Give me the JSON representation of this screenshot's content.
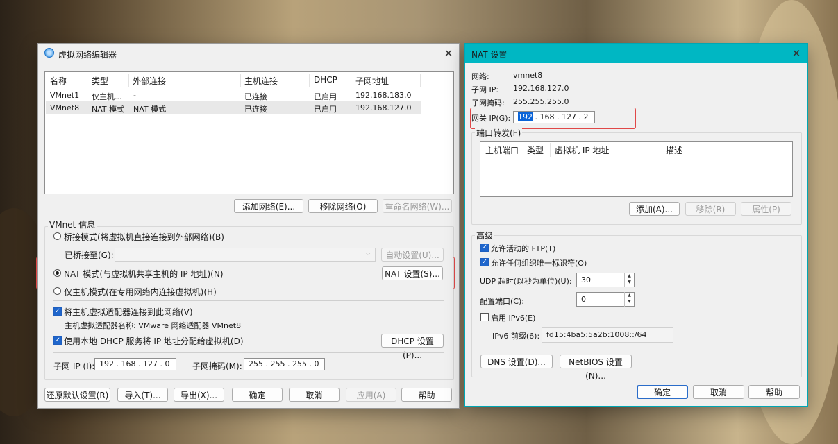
{
  "vne": {
    "title": "虚拟网络编辑器",
    "columns": [
      "名称",
      "类型",
      "外部连接",
      "主机连接",
      "DHCP",
      "子网地址"
    ],
    "rows": [
      [
        "VMnet1",
        "仅主机...",
        "-",
        "已连接",
        "已启用",
        "192.168.183.0"
      ],
      [
        "VMnet8",
        "NAT 模式",
        "NAT 模式",
        "已连接",
        "已启用",
        "192.168.127.0"
      ]
    ],
    "add_network": "添加网络(E)...",
    "remove_network": "移除网络(O)",
    "rename_network": "重命名网络(W)...",
    "vmnet_info": "VMnet 信息",
    "bridge_mode": "桥接模式(将虚拟机直接连接到外部网络)(B)",
    "bridged_to": "已桥接至(G):",
    "auto_settings": "自动设置(U)...",
    "nat_mode": "NAT 模式(与虚拟机共享主机的 IP 地址)(N)",
    "nat_settings": "NAT 设置(S)...",
    "host_only": "仅主机模式(在专用网络内连接虚拟机)(H)",
    "connect_adapter": "将主机虚拟适配器连接到此网络(V)",
    "adapter_name": "主机虚拟适配器名称: VMware 网络适配器 VMnet8",
    "use_dhcp": "使用本地 DHCP 服务将 IP 地址分配给虚拟机(D)",
    "dhcp_settings": "DHCP 设置(P)...",
    "subnet_ip_label": "子网 IP (I):",
    "subnet_ip": "192 . 168 . 127 .  0",
    "subnet_mask_label": "子网掩码(M):",
    "subnet_mask": "255 . 255 . 255 .  0",
    "restore_default": "还原默认设置(R)",
    "import": "导入(T)...",
    "export": "导出(X)...",
    "ok": "确定",
    "cancel": "取消",
    "apply": "应用(A)",
    "help": "帮助"
  },
  "nat": {
    "title": "NAT 设置",
    "network_label": "网络:",
    "network_value": "vmnet8",
    "subnet_ip_label": "子网 IP:",
    "subnet_ip_value": "192.168.127.0",
    "subnet_mask_label": "子网掩码:",
    "subnet_mask_value": "255.255.255.0",
    "gateway_label": "网关 IP(G):",
    "gateway_sel": "192",
    "gateway_rest": " . 168 . 127 .  2",
    "port_forward": "端口转发(F)",
    "pf_columns": [
      "主机端口",
      "类型",
      "虚拟机 IP 地址",
      "描述"
    ],
    "add": "添加(A)...",
    "remove": "移除(R)",
    "properties": "属性(P)",
    "advanced": "高级",
    "allow_ftp": "允许活动的 FTP(T)",
    "allow_uid": "允许任何组织唯一标识符(O)",
    "udp_label": "UDP 超时(以秒为单位)(U):",
    "udp_value": "30",
    "config_port_label": "配置端口(C):",
    "config_port_value": "0",
    "enable_ipv6": "启用 IPv6(E)",
    "ipv6_prefix_label": "IPv6 前缀(6):",
    "ipv6_prefix_value": "fd15:4ba5:5a2b:1008::/64",
    "dns_settings": "DNS 设置(D)...",
    "netbios_settings": "NetBIOS 设置(N)...",
    "ok": "确定",
    "cancel": "取消",
    "help": "帮助"
  },
  "colors": {
    "accent": "#0a64d8",
    "nat_titlebar": "#00b7c3",
    "highlight": "#e04848"
  },
  "icons": {
    "vne_title": "globe-network-icon",
    "close": "close-icon"
  }
}
